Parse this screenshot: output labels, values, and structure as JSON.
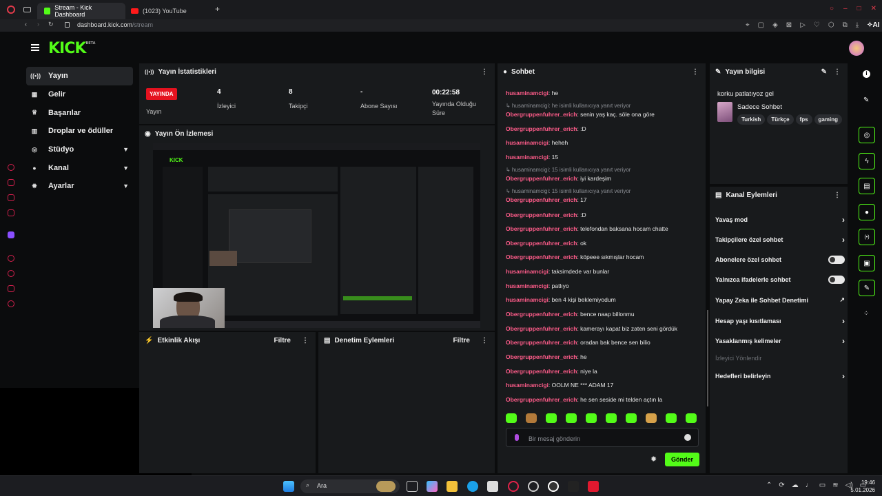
{
  "browser": {
    "tabs": [
      {
        "label": "Stream - Kick Dashboard"
      },
      {
        "label": "(1023) YouTube"
      }
    ],
    "url_domain": "dashboard.kick.com",
    "url_path": "/stream"
  },
  "header": {
    "logo": "KICK",
    "logo_badge": "BETA"
  },
  "nav": {
    "items": [
      {
        "label": "Yayın",
        "icon": "broadcast-icon"
      },
      {
        "label": "Gelir",
        "icon": "chart-icon"
      },
      {
        "label": "Başarılar",
        "icon": "trophy-icon"
      },
      {
        "label": "Droplar ve ödüller",
        "icon": "gift-icon"
      },
      {
        "label": "Stüdyo",
        "icon": "studio-icon"
      },
      {
        "label": "Kanal",
        "icon": "user-icon"
      },
      {
        "label": "Ayarlar",
        "icon": "gear-icon"
      }
    ]
  },
  "stats": {
    "title": "Yayın İstatistikleri",
    "live_badge": "YAYINDA",
    "items": [
      {
        "value": "",
        "label": "Yayın"
      },
      {
        "value": "4",
        "label": "İzleyici"
      },
      {
        "value": "8",
        "label": "Takipçi"
      },
      {
        "value": "-",
        "label": "Abone Sayısı"
      },
      {
        "value": "00:22:58",
        "label": "Yayında Olduğu Süre"
      }
    ]
  },
  "preview": {
    "title": "Yayın Ön İzlemesi"
  },
  "activity": {
    "title": "Etkinlik Akışı",
    "filter": "Filtre"
  },
  "moderation": {
    "title": "Denetim Eylemleri",
    "filter": "Filtre"
  },
  "chat": {
    "title": "Sohbet",
    "messages": [
      {
        "user": "husaminamcigi",
        "text": ": he",
        "color": "#ff5c8a"
      },
      {
        "reply": "husaminamcigi: he isimli kullanıcıya yanıt veriyor"
      },
      {
        "user": "Obergruppenfuhrer_erich",
        "text": ": senin yaş kaç. söle ona göre",
        "color": "#ff5c8a"
      },
      {
        "user": "Obergruppenfuhrer_erich",
        "text": ": :D",
        "color": "#ff5c8a"
      },
      {
        "user": "husaminamcigi",
        "text": ": heheh",
        "color": "#ff5c8a"
      },
      {
        "user": "husaminamcigi",
        "text": ": 15",
        "color": "#ff5c8a"
      },
      {
        "reply": "husaminamcigi: 15 isimli kullanıcıya yanıt veriyor"
      },
      {
        "user": "Obergruppenfuhrer_erich",
        "text": ": iyi kardeşim",
        "color": "#ff5c8a"
      },
      {
        "reply": "husaminamcigi: 15 isimli kullanıcıya yanıt veriyor"
      },
      {
        "user": "Obergruppenfuhrer_erich",
        "text": ": 17",
        "color": "#ff5c8a"
      },
      {
        "user": "Obergruppenfuhrer_erich",
        "text": ": :D",
        "color": "#ff5c8a"
      },
      {
        "user": "Obergruppenfuhrer_erich",
        "text": ": telefondan baksana hocam chatte",
        "color": "#ff5c8a"
      },
      {
        "user": "Obergruppenfuhrer_erich",
        "text": ": ok",
        "color": "#ff5c8a"
      },
      {
        "user": "Obergruppenfuhrer_erich",
        "text": ": köpeee sıkmışlar hocam",
        "color": "#ff5c8a"
      },
      {
        "user": "husaminamcigi",
        "text": ": taksimdede var bunlar",
        "color": "#ff5c8a"
      },
      {
        "user": "husaminamcigi",
        "text": ": patlıyo",
        "color": "#ff5c8a"
      },
      {
        "user": "husaminamcigi",
        "text": ": ben 4 kişi beklemiyodum",
        "color": "#ff5c8a"
      },
      {
        "user": "Obergruppenfuhrer_erich",
        "text": ": bence naap billonmu",
        "color": "#ff5c8a"
      },
      {
        "user": "Obergruppenfuhrer_erich",
        "text": ": kamerayı kapat biz zaten seni gördük",
        "color": "#ff5c8a"
      },
      {
        "user": "Obergruppenfuhrer_erich",
        "text": ": oradan bak bence sen bilio",
        "color": "#ff5c8a"
      },
      {
        "user": "Obergruppenfuhrer_erich",
        "text": ": he",
        "color": "#ff5c8a"
      },
      {
        "user": "Obergruppenfuhrer_erich",
        "text": ": niye la",
        "color": "#ff5c8a"
      },
      {
        "user": "husaminamcigi",
        "text": ": OOLM NE *** ADAM 17",
        "color": "#ff5c8a"
      },
      {
        "user": "Obergruppenfuhrer_erich",
        "text": ": he sen seside mi telden açtın la",
        "color": "#ff5c8a"
      }
    ],
    "input_placeholder": "Bir mesaj gönderin",
    "send_label": "Gönder"
  },
  "stream_info": {
    "title": "Yayın bilgisi",
    "stream_title": "korku patlatıyoz gel",
    "category": "Sadece Sohbet",
    "tags": [
      "Turkish",
      "Türkçe",
      "fps",
      "gaming"
    ]
  },
  "channel_actions": {
    "title": "Kanal Eylemleri",
    "items": [
      {
        "label": "Yavaş mod",
        "control": "chevron"
      },
      {
        "label": "Takipçilere özel sohbet",
        "control": "chevron"
      },
      {
        "label": "Abonelere özel sohbet",
        "control": "toggle"
      },
      {
        "label": "Yalnızca ifadelerle sohbet",
        "control": "toggle"
      },
      {
        "label": "Yapay Zeka ile Sohbet Denetimi",
        "control": "external"
      },
      {
        "label": "Hesap yaşı kısıtlaması",
        "control": "chevron"
      },
      {
        "label": "Yasaklanmış kelimeler",
        "control": "chevron"
      },
      {
        "label": "İzleyici Yönlendir",
        "control": "disabled"
      },
      {
        "label": "Hedefleri belirleyin",
        "control": "chevron"
      }
    ]
  },
  "taskbar": {
    "search": "Ara",
    "time": "19:46",
    "date": "5.01.2026"
  },
  "colors": {
    "accent": "#53fc18",
    "live": "#e5121f",
    "username": "#ff5c8a"
  }
}
